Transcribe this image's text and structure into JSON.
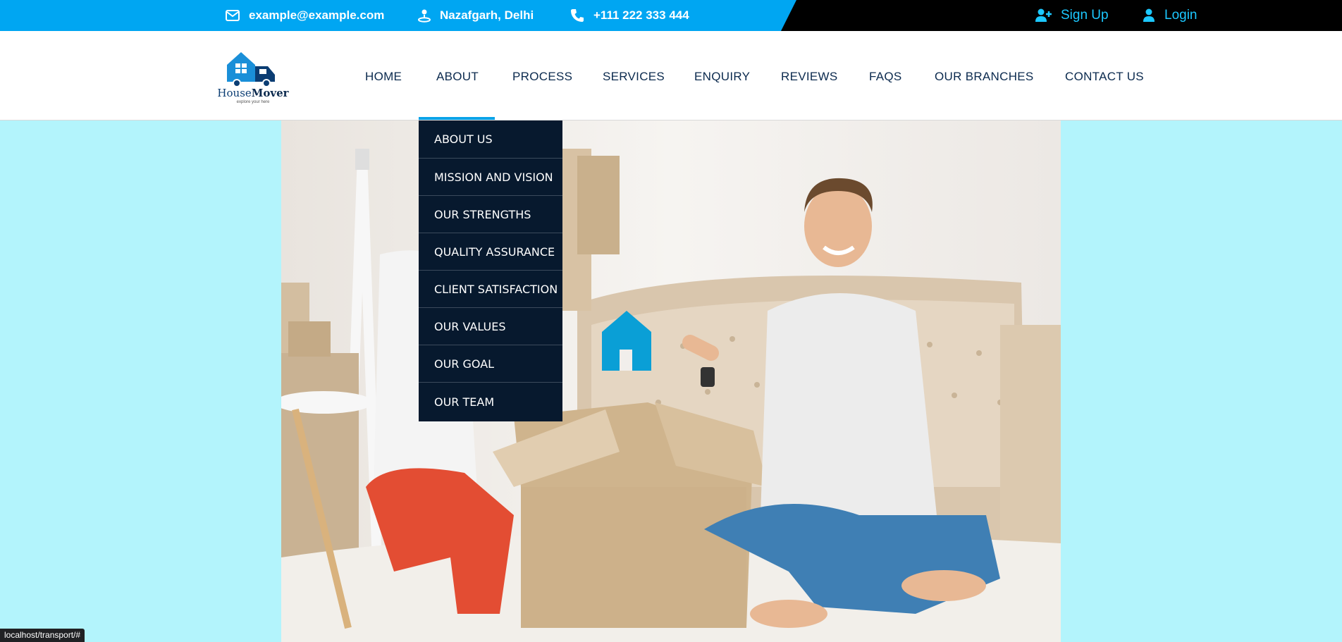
{
  "topbar": {
    "email": "example@example.com",
    "location": "Nazafgarh, Delhi",
    "phone": "+111 222 333 444",
    "signup": "Sign Up",
    "login": "Login"
  },
  "logo": {
    "house": "House",
    "mover": "Mover",
    "tagline": "explore your here"
  },
  "nav": {
    "home": "HOME",
    "about": "ABOUT",
    "process": "PROCESS",
    "services": "SERVICES",
    "enquiry": "ENQUIRY",
    "reviews": "REVIEWS",
    "faqs": "FAQS",
    "branches": "OUR BRANCHES",
    "contact": "CONTACT US"
  },
  "about_menu": [
    "ABOUT US",
    "MISSION AND VISION",
    "OUR STRENGTHS",
    "QUALITY ASSURANCE",
    "CLIENT SATISFACTION",
    "OUR VALUES",
    "OUR GOAL",
    "OUR TEAM"
  ],
  "status_url": "localhost/transport/#",
  "colors": {
    "top_blue": "#00a6f2",
    "navy": "#07192e",
    "page_bg": "#b3f4fc",
    "accent": "#1cc8ff"
  },
  "icons": [
    "envelope-icon",
    "location-pin-icon",
    "phone-icon",
    "user-plus-icon",
    "user-icon",
    "truck-house-logo-icon"
  ]
}
